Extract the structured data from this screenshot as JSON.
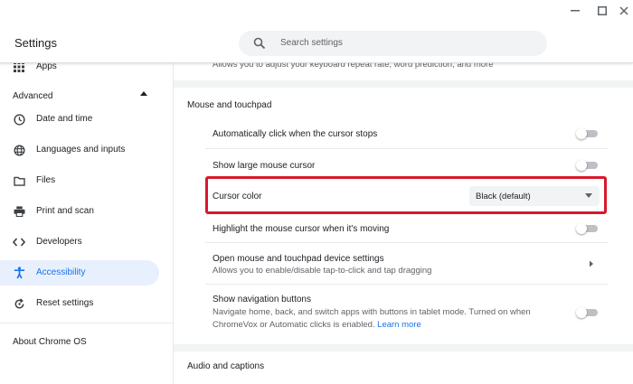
{
  "window": {
    "minimize_glyph": "–",
    "maximize_glyph": "☐",
    "close_glyph": "✕"
  },
  "header": {
    "title": "Settings",
    "search_placeholder": "Search settings"
  },
  "sidebar": {
    "items_top": [
      {
        "label": "Apps",
        "icon": "apps-grid-icon"
      }
    ],
    "advanced_label": "Advanced",
    "advanced_items": [
      {
        "label": "Date and time",
        "icon": "clock-icon"
      },
      {
        "label": "Languages and inputs",
        "icon": "globe-icon"
      },
      {
        "label": "Files",
        "icon": "folder-icon"
      },
      {
        "label": "Print and scan",
        "icon": "printer-icon"
      },
      {
        "label": "Developers",
        "icon": "code-icon"
      },
      {
        "label": "Accessibility",
        "icon": "accessibility-icon",
        "active": true
      },
      {
        "label": "Reset settings",
        "icon": "reset-icon"
      }
    ],
    "about_label": "About Chrome OS"
  },
  "main": {
    "truncated_text": "Allows you to adjust your keyboard repeat rate, word prediction, and more",
    "section_mouse": "Mouse and touchpad",
    "rows": {
      "autoclick": {
        "label": "Automatically click when the cursor stops",
        "on": false
      },
      "large_cursor": {
        "label": "Show large mouse cursor",
        "on": false
      },
      "cursor_color": {
        "label": "Cursor color",
        "value": "Black (default)"
      },
      "highlight_cursor": {
        "label": "Highlight the mouse cursor when it's moving",
        "on": false
      },
      "device_settings": {
        "label": "Open mouse and touchpad device settings",
        "sub": "Allows you to enable/disable tap-to-click and tap dragging"
      },
      "nav_buttons": {
        "label": "Show navigation buttons",
        "sub_line1": "Navigate home, back, and switch apps with buttons in tablet mode. Turned on when",
        "sub_line2": "ChromeVox or Automatic clicks is enabled.",
        "link": "Learn more",
        "on": false
      }
    },
    "section_audio": "Audio and captions"
  },
  "colors": {
    "accent": "#1a73e8",
    "active_bg": "#e8f0fe",
    "highlight_border": "#d7192b"
  }
}
